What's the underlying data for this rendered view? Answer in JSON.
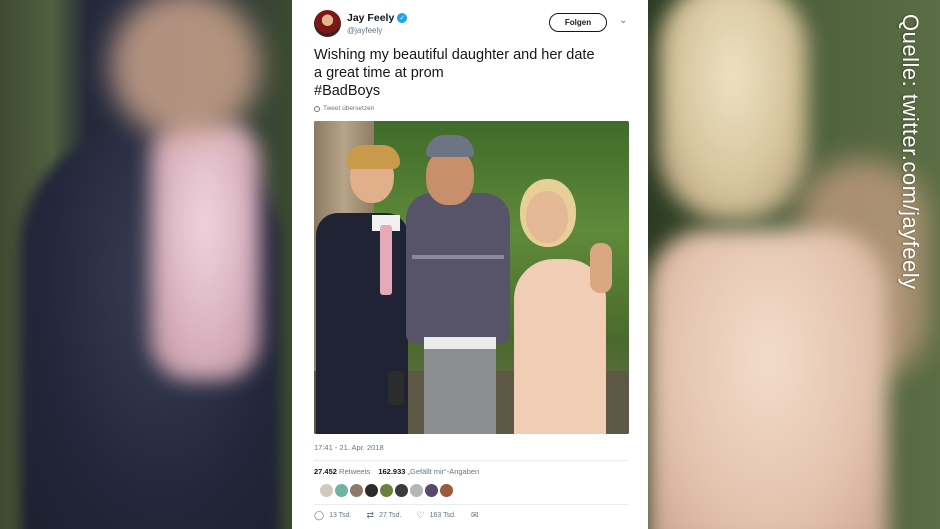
{
  "source_label": "Quelle: twitter.com/jayfeely",
  "tweet": {
    "author_name": "Jay Feely",
    "author_handle": "@jayfeely",
    "follow_label": "Folgen",
    "text_line1": "Wishing my beautiful daughter and her date",
    "text_line2": "a great time at prom",
    "hashtag": "#BadBoys",
    "translate_label": "Tweet übersetzen",
    "timestamp": "17:41 - 21. Apr. 2018",
    "retweets_count": "27.452",
    "retweets_label": "Retweets",
    "likes_count": "162.933",
    "likes_label": "„Gefällt mir“-Angaben",
    "reply_count": "13 Tsd.",
    "retweet_count_short": "27 Tsd.",
    "like_count_short": "163 Tsd.",
    "liker_colors": [
      "#cfc9bf",
      "#6fb3a3",
      "#8d7b6a",
      "#2b2b2b",
      "#6c7f3e",
      "#3b3b3b",
      "#b5b5b5",
      "#5a4a6a",
      "#9a5a3a"
    ]
  },
  "colors": {
    "link": "#1da1f2",
    "text": "#14171a",
    "muted": "#657786"
  }
}
